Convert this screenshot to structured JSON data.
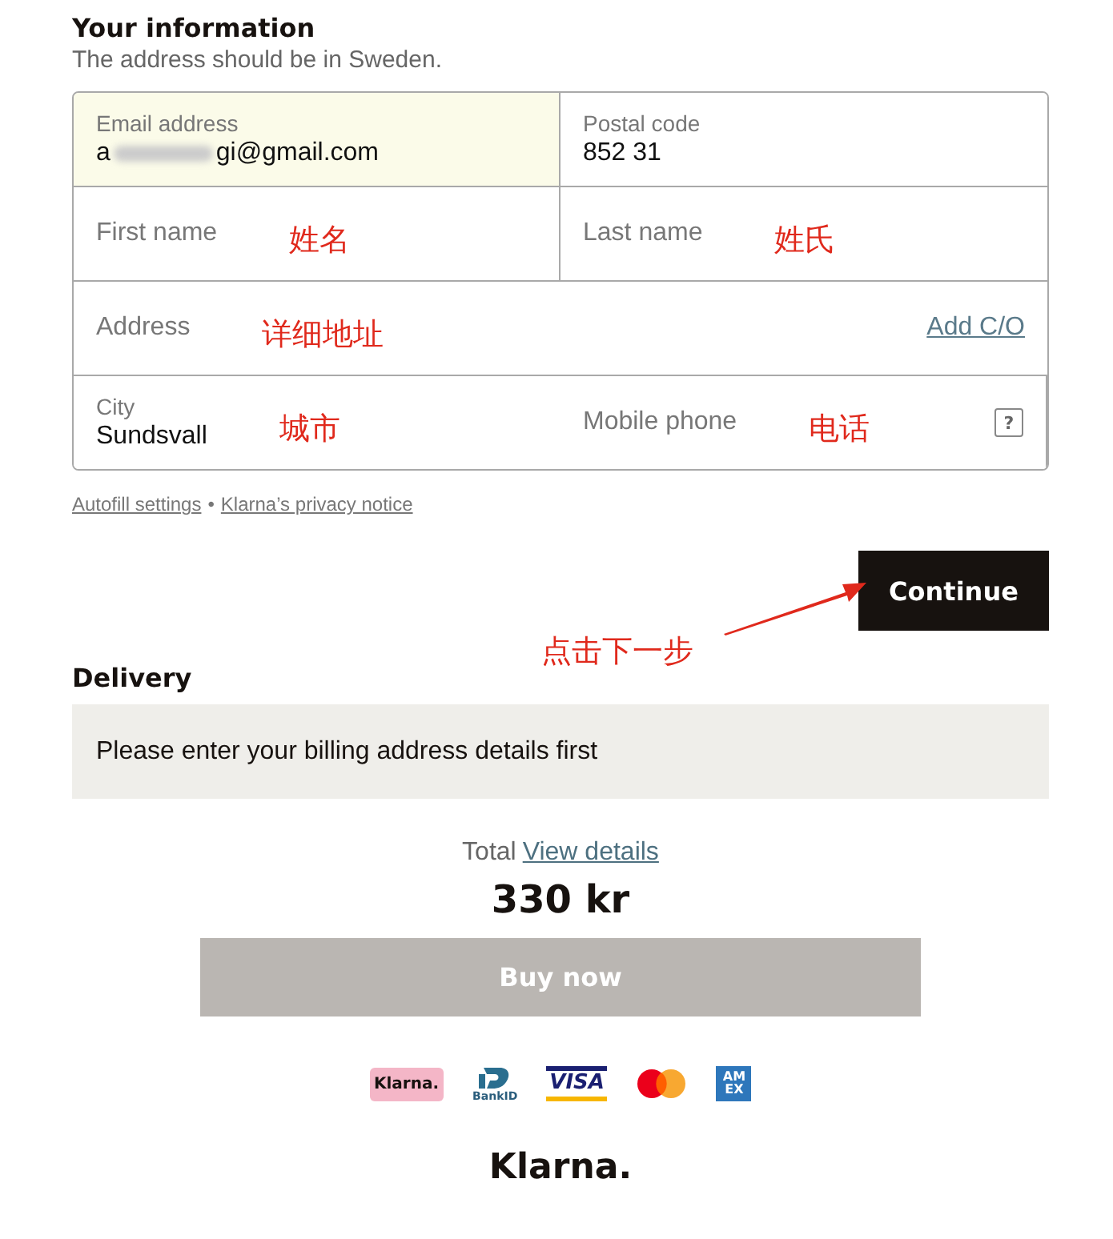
{
  "section": {
    "title": "Your information",
    "subtitle": "The address should be in Sweden."
  },
  "fields": [
    {
      "label": "Email address",
      "value_start": "a",
      "value_end": "gi@gmail.com",
      "blurred": true,
      "highlighted": true,
      "wide": false
    },
    {
      "label": "Postal code",
      "value_end": "852 31",
      "blurred": false,
      "highlighted": false,
      "wide": false
    },
    {
      "label": "First name",
      "note": "姓名",
      "highlighted": false,
      "wide": false
    },
    {
      "label": "Last name",
      "note": "姓氏",
      "highlighted": false,
      "wide": false
    },
    {
      "label": "Address",
      "note": "详细地址",
      "link": "Add C/O",
      "highlighted": false,
      "wide": true
    },
    {
      "label": "City",
      "value_end": "Sundsvall",
      "note": "城市",
      "blurred": false,
      "highlighted": false,
      "wide": false
    },
    {
      "label": "Mobile phone",
      "note": "电话",
      "help": "?",
      "highlighted": false,
      "wide": false
    }
  ],
  "links": [
    "Autofill settings",
    "Klarna’s privacy notice"
  ],
  "link_separator": "•",
  "continue_button": "Continue",
  "continue_note": "点击下一步",
  "delivery": {
    "title": "Delivery",
    "message": "Please enter your billing address details first"
  },
  "total": {
    "label": "Total",
    "link": "View details",
    "amount": "330 kr"
  },
  "buy_button": {
    "label": "Buy now",
    "disabled": true
  },
  "payment_logos": [
    {
      "kind": "klarna",
      "text": "Klarna."
    },
    {
      "kind": "bankid",
      "text": "BankID"
    },
    {
      "kind": "visa",
      "text": "VISA"
    },
    {
      "kind": "mastercard"
    },
    {
      "kind": "amex",
      "text": "AM EX"
    }
  ],
  "brand": "Klarna."
}
